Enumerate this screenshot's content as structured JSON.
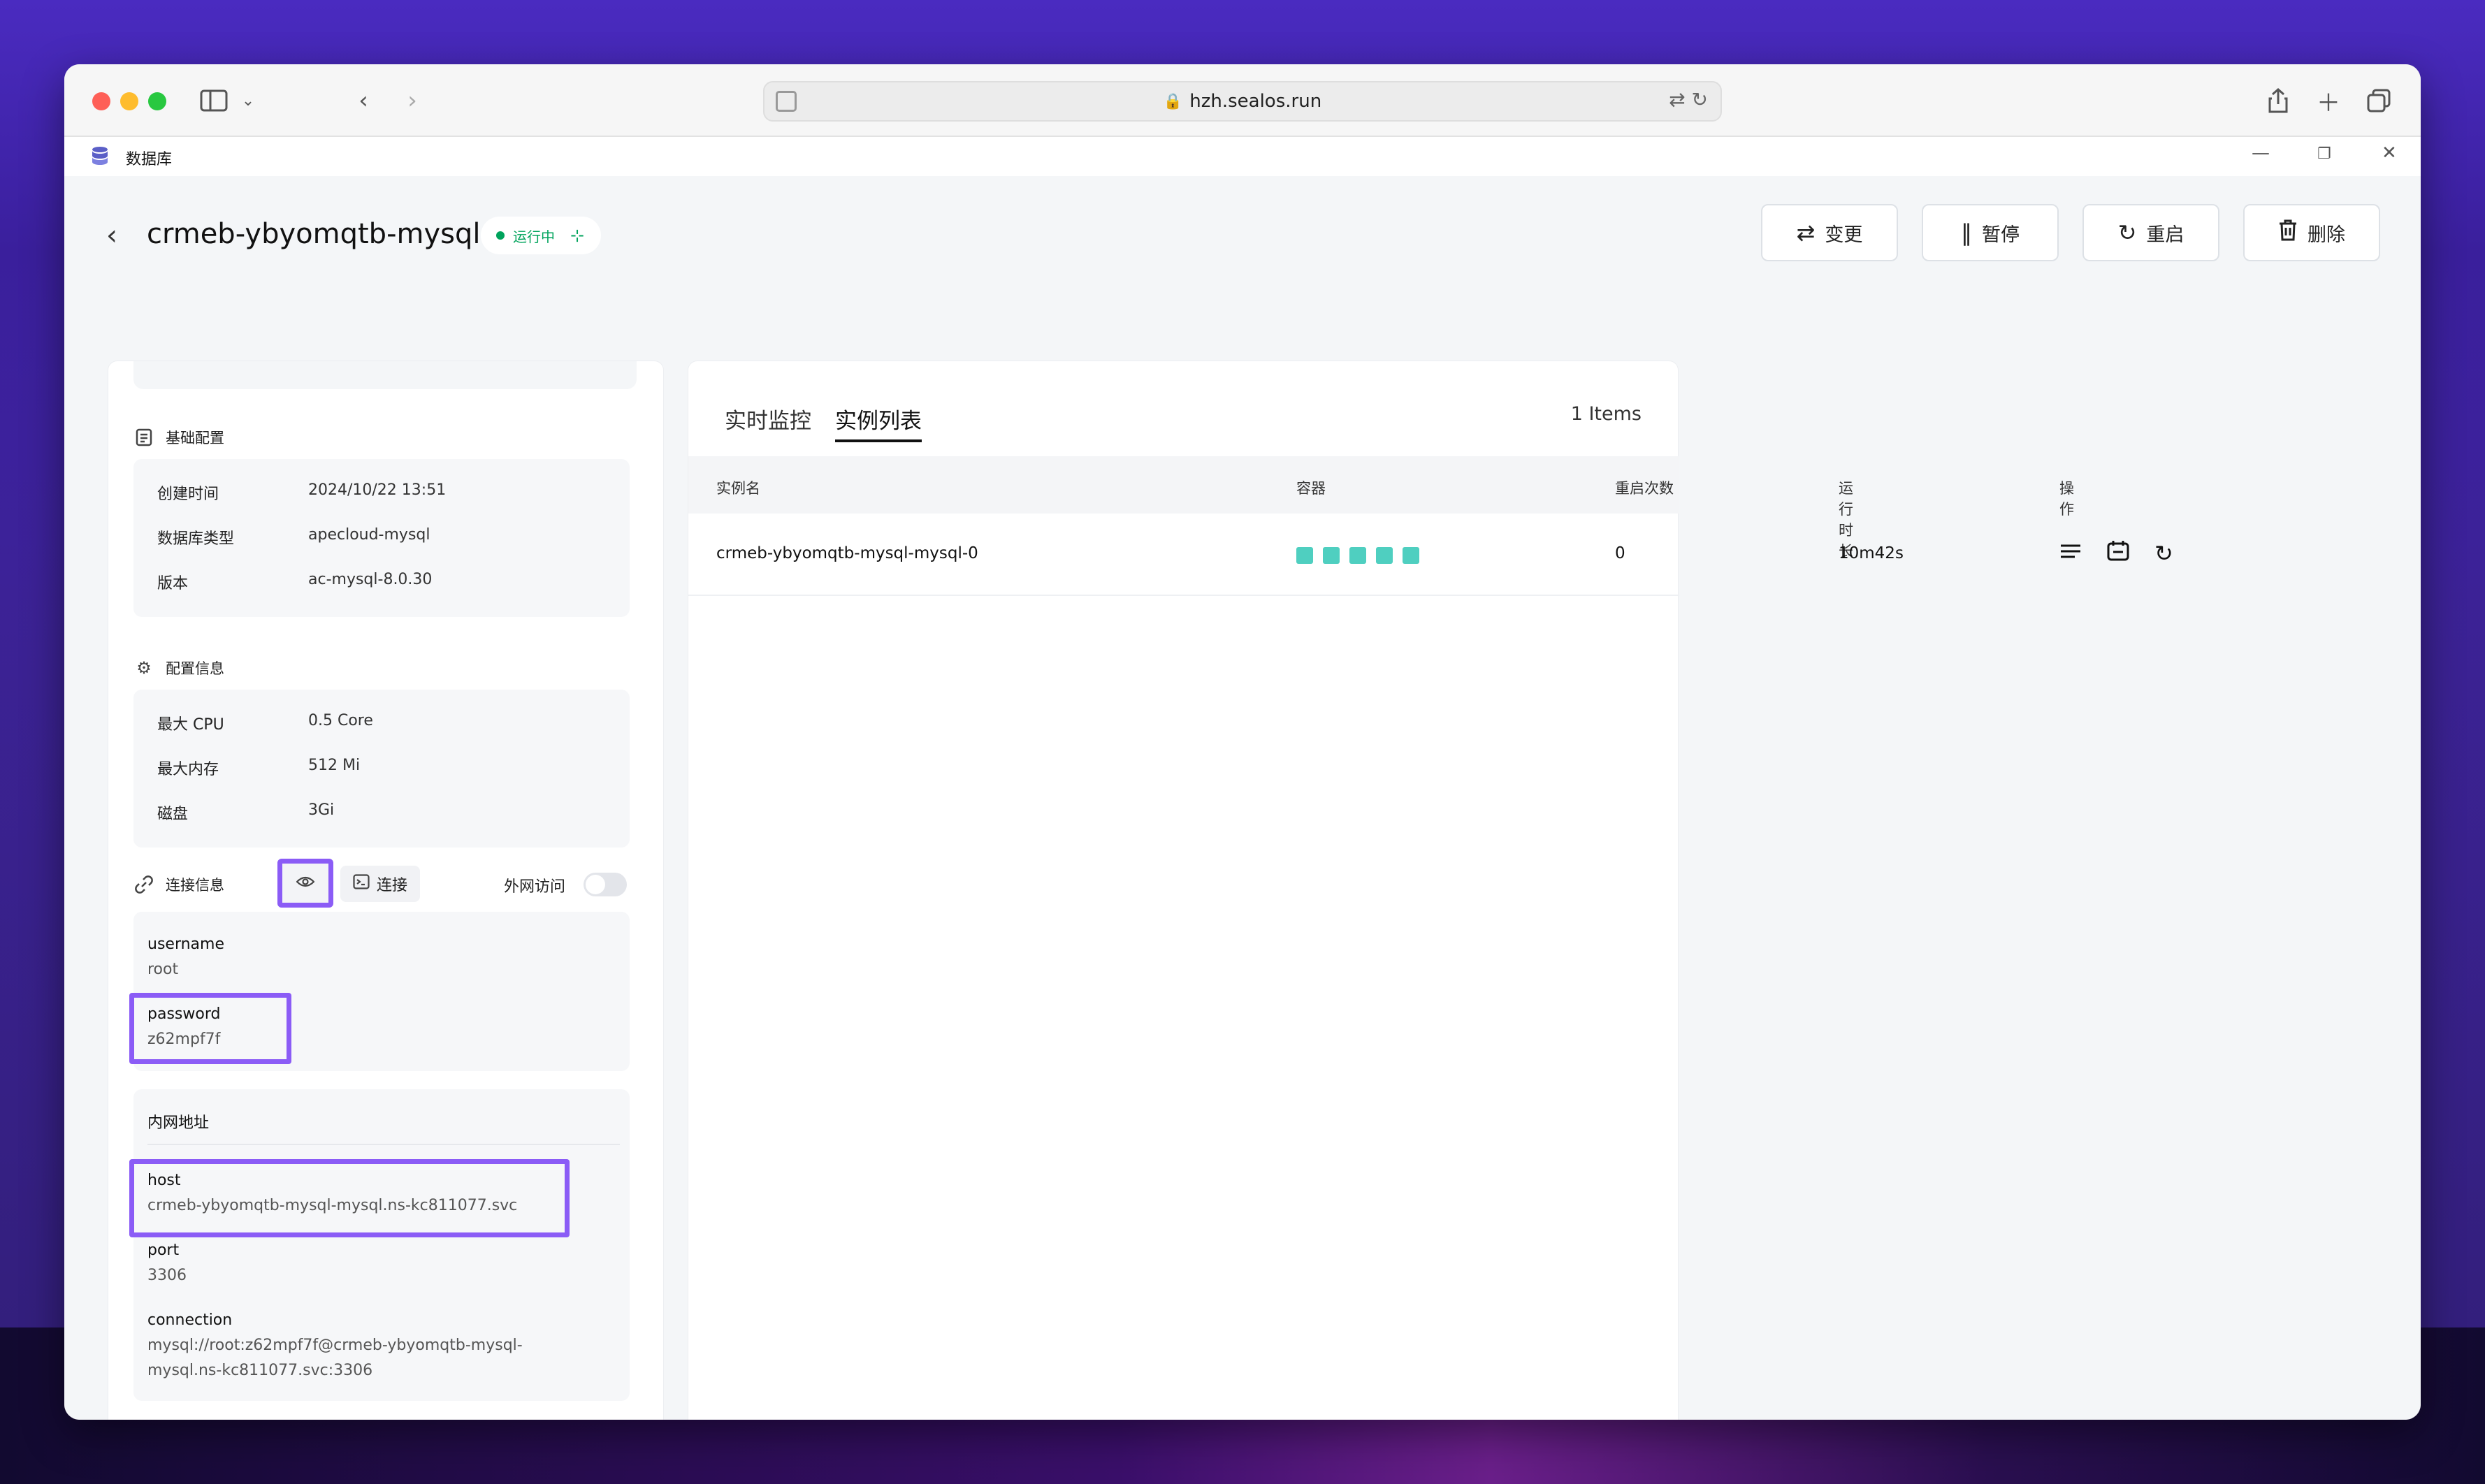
{
  "browser": {
    "url": "hzh.sealos.run"
  },
  "app": {
    "title": "数据库"
  },
  "header": {
    "back_label": "‹",
    "db_name": "crmeb-ybyomqtb-mysql",
    "status": "运行中",
    "buttons": {
      "change": "变更",
      "pause": "暂停",
      "restart": "重启",
      "delete": "删除"
    }
  },
  "basic": {
    "title": "基础配置",
    "rows": [
      {
        "label": "创建时间",
        "value": "2024/10/22 13:51"
      },
      {
        "label": "数据库类型",
        "value": "apecloud-mysql"
      },
      {
        "label": "版本",
        "value": "ac-mysql-8.0.30"
      }
    ]
  },
  "config": {
    "title": "配置信息",
    "rows": [
      {
        "label": "最大 CPU",
        "value": "0.5 Core"
      },
      {
        "label": "最大内存",
        "value": "512 Mi"
      },
      {
        "label": "磁盘",
        "value": "3Gi"
      }
    ]
  },
  "connection": {
    "title": "连接信息",
    "connect_label": "连接",
    "external_label": "外网访问",
    "external_enabled": false,
    "username_label": "username",
    "username": "root",
    "password_label": "password",
    "password": "z62mpf7f",
    "internal_title": "内网地址",
    "host_label": "host",
    "host": "crmeb-ybyomqtb-mysql-mysql.ns-kc811077.svc",
    "port_label": "port",
    "port": "3306",
    "conn_label": "connection",
    "conn_line1": "mysql://root:z62mpf7f@crmeb-ybyomqtb-mysql-",
    "conn_line2": "mysql.ns-kc811077.svc:3306"
  },
  "tabs": {
    "monitor": "实时监控",
    "instances": "实例列表",
    "items_count": "1 Items"
  },
  "table": {
    "headers": {
      "name": "实例名",
      "containers": "容器",
      "restarts": "重启次数",
      "uptime": "运行时长",
      "actions": "操作"
    },
    "rows": [
      {
        "name": "crmeb-ybyomqtb-mysql-mysql-0",
        "restarts": "0",
        "uptime": "10m42s",
        "container_count": 5
      }
    ]
  },
  "colors": {
    "accent_highlight": "#8b5cf6",
    "running": "#00a35c",
    "container_ok": "#4fcfc0"
  }
}
